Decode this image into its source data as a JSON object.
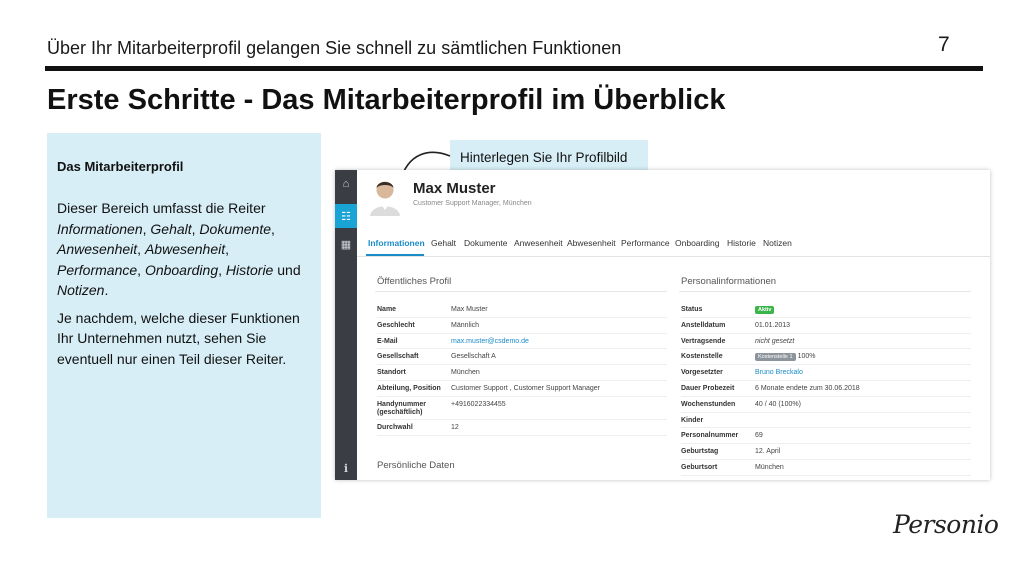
{
  "slide": {
    "header": "Über Ihr Mitarbeiterprofil gelangen Sie schnell zu sämtlichen Funktionen",
    "page_number": "7",
    "title": "Erste Schritte - Das Mitarbeiterprofil im Überblick",
    "logo_text": "Personio"
  },
  "info_box": {
    "heading": "Das Mitarbeiterprofil",
    "para1_intro": "Dieser Bereich umfasst die Reiter ",
    "para1_tabs": [
      "Informationen",
      "Gehalt",
      "Dokumente",
      "Anwesenheit",
      "Abwesenheit",
      "Performance",
      "Onboarding",
      "Historie",
      "Notizen"
    ],
    "para1_sep": ", ",
    "para1_and": " und ",
    "para1_end": ".",
    "para2": "Je nachdem, welche dieser Funktionen Ihr Unternehmen nutzt, sehen Sie eventuell nur einen Teil dieser Reiter."
  },
  "callout": "Hinterlegen Sie Ihr Profilbild",
  "colors": {
    "accent": "#1aa3d5",
    "link": "#1a8cc8",
    "status_green": "#3bb54a",
    "panel": "#d7eef6"
  },
  "app": {
    "rail_icons": [
      "home-icon",
      "team-icon",
      "calendar-icon",
      "info-icon"
    ],
    "profile": {
      "name": "Max Muster",
      "subtitle": "Customer Support Manager, München"
    },
    "tabs": [
      "Informationen",
      "Gehalt",
      "Dokumente",
      "Anwesenheit",
      "Abwesenheit",
      "Performance",
      "Onboarding",
      "Historie",
      "Notizen"
    ],
    "public_profile": {
      "title": "Öffentliches Profil",
      "rows": [
        {
          "label": "Name",
          "value": "Max Muster"
        },
        {
          "label": "Geschlecht",
          "value": "Männlich"
        },
        {
          "label": "E-Mail",
          "value": "max.muster@csdemo.de",
          "link": true
        },
        {
          "label": "Gesellschaft",
          "value": "Gesellschaft A"
        },
        {
          "label": "Standort",
          "value": "München"
        },
        {
          "label": "Abteilung, Position",
          "value": "Customer Support , Customer Support Manager"
        },
        {
          "label": "Handynummer (geschäftlich)",
          "value": "+4916022334455",
          "tall": true
        },
        {
          "label": "Durchwahl",
          "value": "12"
        }
      ]
    },
    "personal_info": {
      "title": "Personalinformationen",
      "rows": [
        {
          "label": "Status",
          "badge": "Aktiv"
        },
        {
          "label": "Anstelldatum",
          "value": "01.01.2013"
        },
        {
          "label": "Vertragsende",
          "value": "nicht gesetzt",
          "italic": true
        },
        {
          "label": "Kostenstelle",
          "tag": "Kostenstelle 1",
          "value": "100%"
        },
        {
          "label": "Vorgesetzter",
          "value": "Bruno Breckalo",
          "link": true
        },
        {
          "label": "Dauer Probezeit",
          "value": "6 Monate endete zum 30.06.2018"
        },
        {
          "label": "Wochenstunden",
          "value": "40 / 40 (100%)"
        },
        {
          "label": "Kinder",
          "value": ""
        },
        {
          "label": "Personalnummer",
          "value": "69"
        },
        {
          "label": "Geburtstag",
          "value": "12. April"
        },
        {
          "label": "Geburtsort",
          "value": "München"
        }
      ]
    },
    "personal_data_title": "Persönliche Daten"
  }
}
